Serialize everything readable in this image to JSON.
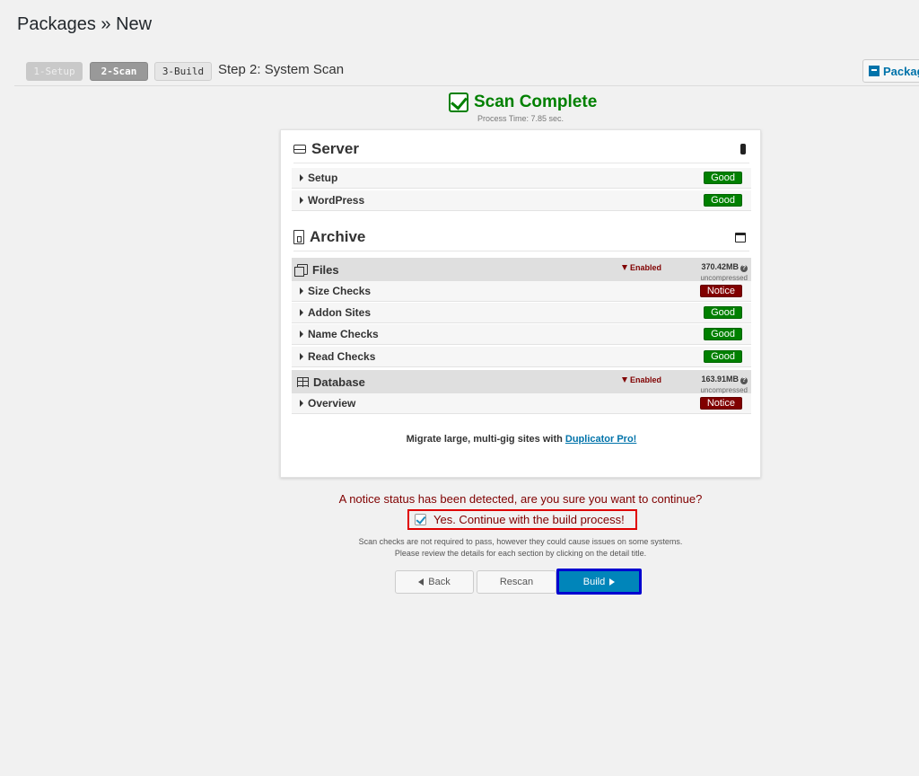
{
  "page": {
    "title": "Packages » New"
  },
  "steps": {
    "step1": "1-Setup",
    "step2": "2-Scan",
    "step3": "3-Build",
    "current_title": "Step 2: System Scan"
  },
  "packages_link": "Packag",
  "scan": {
    "title": "Scan Complete",
    "process_time": "Process Time: 7.85 sec."
  },
  "server": {
    "label": "Server",
    "rows": [
      {
        "label": "Setup",
        "status": "Good"
      },
      {
        "label": "WordPress",
        "status": "Good"
      }
    ]
  },
  "archive": {
    "label": "Archive",
    "files": {
      "label": "Files",
      "filter": "Enabled",
      "size": "370.42MB",
      "size_note": "uncompressed",
      "rows": [
        {
          "label": "Size Checks",
          "status": "Notice"
        },
        {
          "label": "Addon Sites",
          "status": "Good"
        },
        {
          "label": "Name Checks",
          "status": "Good"
        },
        {
          "label": "Read Checks",
          "status": "Good"
        }
      ]
    },
    "database": {
      "label": "Database",
      "filter": "Enabled",
      "size": "163.91MB",
      "size_note": "uncompressed",
      "rows": [
        {
          "label": "Overview",
          "status": "Notice"
        }
      ]
    }
  },
  "promo": {
    "text": "Migrate large, multi-gig sites with ",
    "link": "Duplicator Pro!"
  },
  "notice": {
    "message": "A notice status has been detected, are you sure you want to continue?",
    "confirm_label": "Yes. Continue with the build process!",
    "hint_line1": "Scan checks are not required to pass, however they could cause issues on some systems.",
    "hint_line2": "Please review the details for each section by clicking on the detail title."
  },
  "buttons": {
    "back": "Back",
    "rescan": "Rescan",
    "build": "Build"
  },
  "colors": {
    "good": "#008000",
    "notice": "#800000",
    "primary": "#0085ba"
  }
}
